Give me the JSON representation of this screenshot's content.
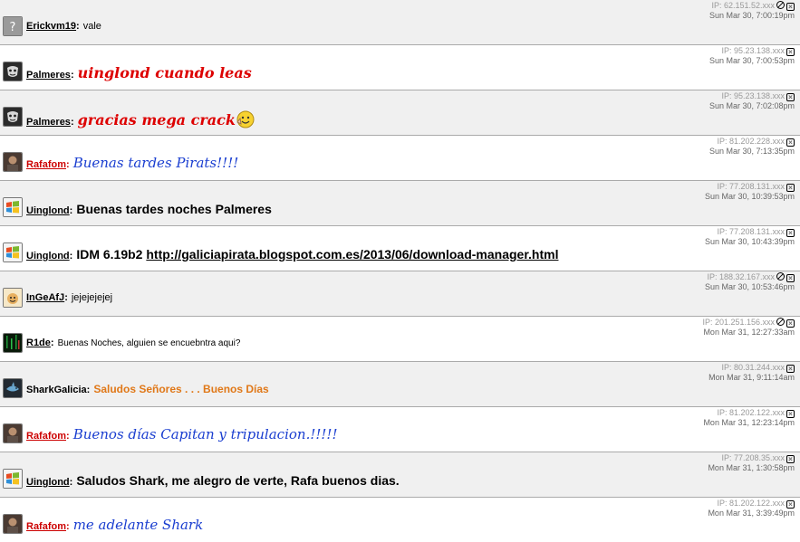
{
  "shouts": [
    {
      "user": "Erickvm19",
      "user_color": "#000000",
      "avatar": "question-avatar",
      "message": "vale",
      "style": "plain",
      "ip": "IP: 62.151.52.xxx",
      "date": "Sun Mar 30, 7:00:19pm",
      "controls": [
        "block",
        "delete"
      ]
    },
    {
      "user": "Palmeres",
      "user_color": "#000000",
      "avatar": "mask-avatar",
      "message": "uinglond cuando leas",
      "style": "cursive",
      "ip": "IP: 95.23.138.xxx",
      "date": "Sun Mar 30, 7:00:53pm",
      "controls": [
        "delete"
      ]
    },
    {
      "user": "Palmeres",
      "user_color": "#000000",
      "avatar": "mask-avatar",
      "message": "gracias mega crack",
      "style": "cursive",
      "ip": "IP: 95.23.138.xxx",
      "date": "Sun Mar 30, 7:02:08pm",
      "controls": [
        "delete"
      ],
      "emoji": "thumbs-up-smiley-icon"
    },
    {
      "user": "Rafafom",
      "user_color": "#cc0000",
      "avatar": "portrait-avatar",
      "message": "Buenas tardes Pirats!!!!",
      "style": "script",
      "ip": "IP: 81.202.228.xxx",
      "date": "Sun Mar 30, 7:13:35pm",
      "controls": [
        "delete"
      ]
    },
    {
      "user": "Uinglond",
      "user_color": "#000000",
      "avatar": "windows-avatar",
      "message": "Buenas tardes noches  Palmeres",
      "style": "bold",
      "ip": "IP: 77.208.131.xxx",
      "date": "Sun Mar 30, 10:39:53pm",
      "controls": [
        "delete"
      ]
    },
    {
      "user": "Uinglond",
      "user_color": "#000000",
      "avatar": "windows-avatar",
      "message": "IDM 6.19b2 ",
      "link": "http://galiciapirata.blogspot.com.es/2013/06/download-manager.html",
      "style": "bold",
      "ip": "IP: 77.208.131.xxx",
      "date": "Sun Mar 30, 10:43:39pm",
      "controls": [
        "delete"
      ]
    },
    {
      "user": "InGeAfJ",
      "user_color": "#000000",
      "avatar": "cartoon-avatar",
      "message": "jejejejejej",
      "style": "plain",
      "ip": "IP: 188.32.167.xxx",
      "date": "Sun Mar 30, 10:53:46pm",
      "controls": [
        "block",
        "delete"
      ]
    },
    {
      "user": "R1de",
      "user_color": "#000000",
      "avatar": "matrix-avatar",
      "message": "Buenas Noches, alguien se encuebntra aqui?",
      "style": "plain10",
      "ip": "IP: 201.251.156.xxx",
      "date": "Mon Mar 31, 12:27:33am",
      "controls": [
        "block",
        "delete"
      ]
    },
    {
      "user": "SharkGalicia",
      "user_color": "#000000",
      "avatar": "shark-avatar",
      "message": "Saludos Señores . . . Buenos Días",
      "style": "orange",
      "ip": "IP: 80.31.244.xxx",
      "date": "Mon Mar 31, 9:11:14am",
      "controls": [
        "delete"
      ]
    },
    {
      "user": "Rafafom",
      "user_color": "#cc0000",
      "avatar": "portrait-avatar",
      "message": "Buenos días Capitan y tripulacion.!!!!!",
      "style": "script",
      "ip": "IP: 81.202.122.xxx",
      "date": "Mon Mar 31, 12:23:14pm",
      "controls": [
        "delete"
      ]
    },
    {
      "user": "Uinglond",
      "user_color": "#000000",
      "avatar": "windows-avatar",
      "message": "Saludos Shark, me alegro de verte, Rafa buenos dias.",
      "style": "bold",
      "ip": "IP: 77.208.35.xxx",
      "date": "Mon Mar 31, 1:30:58pm",
      "controls": [
        "delete"
      ]
    },
    {
      "user": "Rafafom",
      "user_color": "#cc0000",
      "avatar": "portrait-avatar",
      "message": "me adelante Shark",
      "style": "script",
      "ip": "IP: 81.202.122.xxx",
      "date": "Mon Mar 31, 3:39:49pm",
      "controls": [
        "delete"
      ]
    }
  ],
  "colors": {
    "row_alt": "#f0f0f0",
    "row_border": "#aaaaaa",
    "cursive_red": "#dd0000",
    "script_blue": "#1a3ed0",
    "orange": "#e07818",
    "user_red": "#cc0000"
  }
}
